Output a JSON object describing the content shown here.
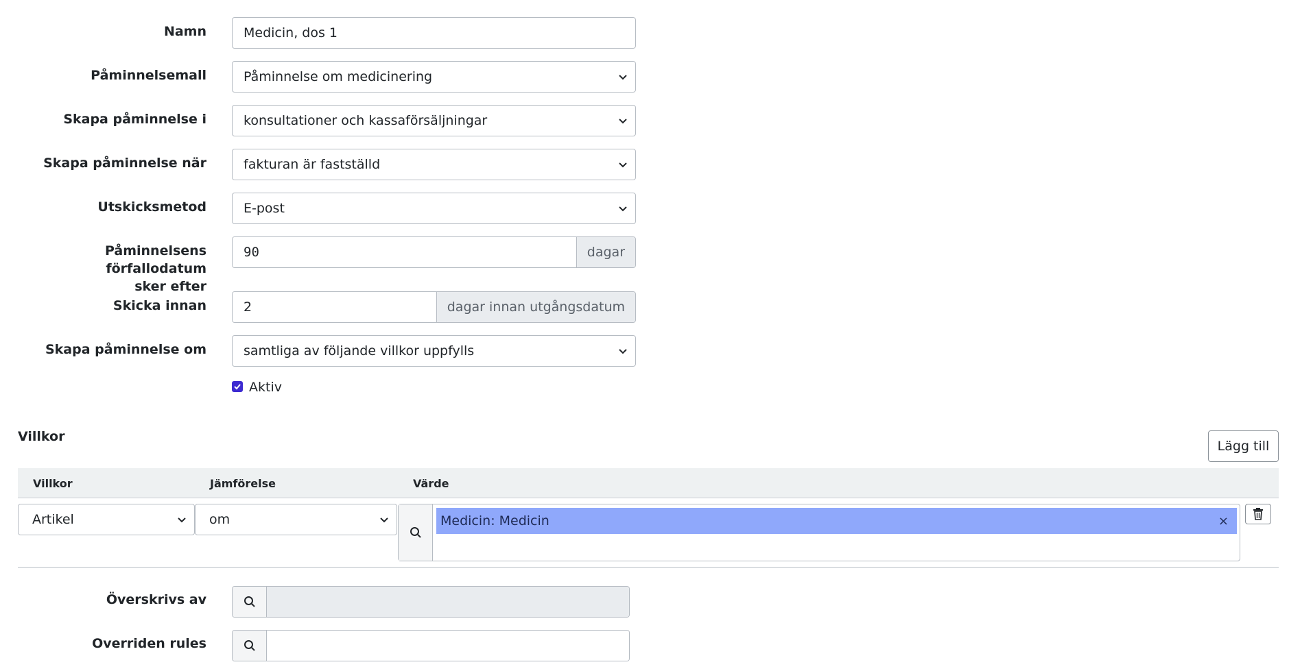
{
  "form": {
    "name": {
      "label": "Namn",
      "value": "Medicin, dos 1"
    },
    "template": {
      "label": "Påminnelsemall",
      "value": "Påminnelse om medicinering"
    },
    "create_in": {
      "label": "Skapa påminnelse i",
      "value": "konsultationer och kassaförsäljningar"
    },
    "create_when": {
      "label": "Skapa påminnelse när",
      "value": "fakturan är fastställd"
    },
    "send_method": {
      "label": "Utskicksmetod",
      "value": "E-post"
    },
    "due_after": {
      "label_line1": "Påminnelsens förfallodatum",
      "label_line2": "sker efter",
      "value": "90",
      "unit": "dagar"
    },
    "send_before": {
      "label": "Skicka innan",
      "value": "2",
      "unit": "dagar innan utgångsdatum"
    },
    "create_if": {
      "label": "Skapa påminnelse om",
      "value": "samtliga av följande villkor uppfylls"
    },
    "active": {
      "label": "Aktiv",
      "checked": true
    }
  },
  "conditions": {
    "title": "Villkor",
    "add_label": "Lägg till",
    "columns": [
      "Villkor",
      "Jämförelse",
      "Värde"
    ],
    "rows": [
      {
        "condition": "Artikel",
        "comparison": "om",
        "value_tag": "Medicin: Medicin",
        "remove": "×"
      }
    ]
  },
  "overrides": {
    "overridden_by": {
      "label": "Överskrivs av",
      "value": ""
    },
    "overriden_rules": {
      "label": "Overriden rules",
      "value": ""
    }
  },
  "colors": {
    "accent": "#3d2bd1",
    "tag_bg": "#8fa8fb",
    "addon_bg": "#e9ecef",
    "header_bg": "#eef1f2"
  }
}
